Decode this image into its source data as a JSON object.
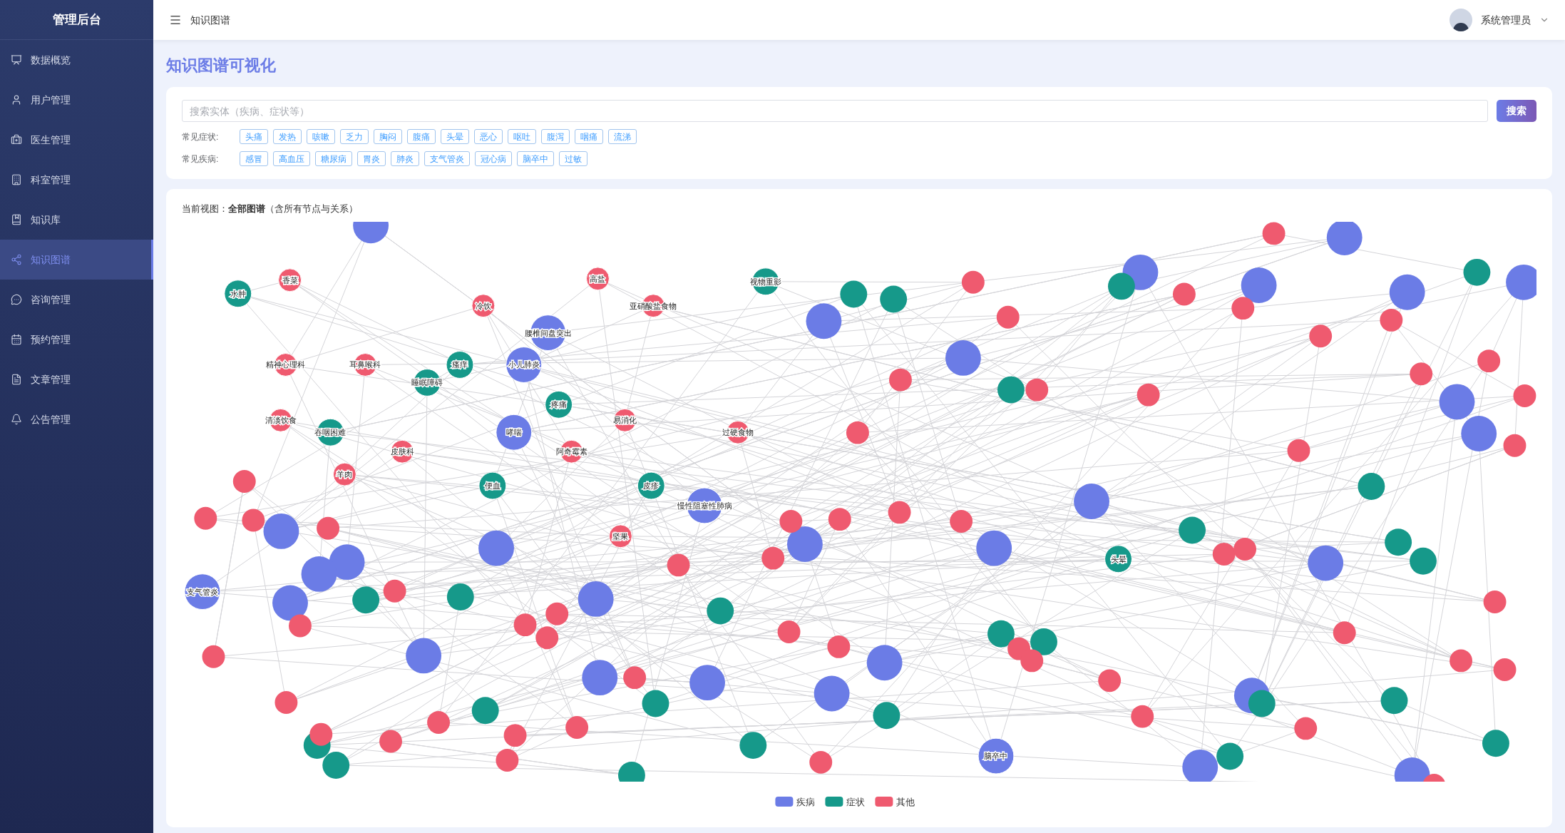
{
  "sidebar": {
    "title": "管理后台",
    "items": [
      {
        "label": "数据概览",
        "selected": false
      },
      {
        "label": "用户管理",
        "selected": false
      },
      {
        "label": "医生管理",
        "selected": false
      },
      {
        "label": "科室管理",
        "selected": false
      },
      {
        "label": "知识库",
        "selected": false
      },
      {
        "label": "知识图谱",
        "selected": true
      },
      {
        "label": "咨询管理",
        "selected": false
      },
      {
        "label": "预约管理",
        "selected": false
      },
      {
        "label": "文章管理",
        "selected": false
      },
      {
        "label": "公告管理",
        "selected": false
      }
    ]
  },
  "header": {
    "breadcrumb": "知识图谱",
    "user": "系统管理员"
  },
  "page_title": "知识图谱可视化",
  "search": {
    "placeholder": "搜索实体（疾病、症状等）",
    "button": "搜索",
    "tag_groups": [
      {
        "label": "常见症状:",
        "tags": [
          "头痛",
          "发热",
          "咳嗽",
          "乏力",
          "胸闷",
          "腹痛",
          "头晕",
          "恶心",
          "呕吐",
          "腹泻",
          "咽痛",
          "流涕"
        ]
      },
      {
        "label": "常见疾病:",
        "tags": [
          "感冒",
          "高血压",
          "糖尿病",
          "胃炎",
          "肺炎",
          "支气管炎",
          "冠心病",
          "脑卒中",
          "过敏"
        ]
      }
    ]
  },
  "graph": {
    "view_text": "当前视图：**全部图谱**（含所有节点与关系）",
    "legend": [
      {
        "kind": "disease",
        "label": "疾病",
        "color": "#6b7ce6"
      },
      {
        "kind": "symptom",
        "label": "症状",
        "color": "#16998a"
      },
      {
        "kind": "other",
        "label": "其他",
        "color": "#ef5a6f"
      }
    ],
    "nodes": [
      {
        "label": "香菜",
        "kind": "other"
      },
      {
        "label": "高盐",
        "kind": "other"
      },
      {
        "label": "视物重影",
        "kind": "symptom"
      },
      {
        "label": "水肿",
        "kind": "symptom"
      },
      {
        "label": "冷饮",
        "kind": "other"
      },
      {
        "label": "亚硝酸盐食物",
        "kind": "other"
      },
      {
        "label": "腰椎间盘突出",
        "kind": "disease"
      },
      {
        "label": "精神心理科",
        "kind": "other"
      },
      {
        "label": "耳鼻喉科",
        "kind": "other"
      },
      {
        "label": "瘙痒",
        "kind": "symptom"
      },
      {
        "label": "小儿肺炎",
        "kind": "disease"
      },
      {
        "label": "睡眠障碍",
        "kind": "symptom"
      },
      {
        "label": "疼痛",
        "kind": "symptom"
      },
      {
        "label": "清淡饮食",
        "kind": "other"
      },
      {
        "label": "易消化",
        "kind": "other"
      },
      {
        "label": "吞咽困难",
        "kind": "symptom"
      },
      {
        "label": "哮喘",
        "kind": "disease"
      },
      {
        "label": "过硬食物",
        "kind": "other"
      },
      {
        "label": "皮肤科",
        "kind": "other"
      },
      {
        "label": "阿奇霉素",
        "kind": "other"
      },
      {
        "label": "羊肉",
        "kind": "other"
      },
      {
        "label": "便血",
        "kind": "symptom"
      },
      {
        "label": "皮疹",
        "kind": "symptom"
      },
      {
        "label": "慢性阻塞性肺病",
        "kind": "disease"
      },
      {
        "label": "坚果",
        "kind": "other"
      },
      {
        "label": "支气管炎",
        "kind": "disease"
      },
      {
        "label": "头晕",
        "kind": "symptom"
      },
      {
        "label": "脑卒中",
        "kind": "disease"
      }
    ]
  }
}
